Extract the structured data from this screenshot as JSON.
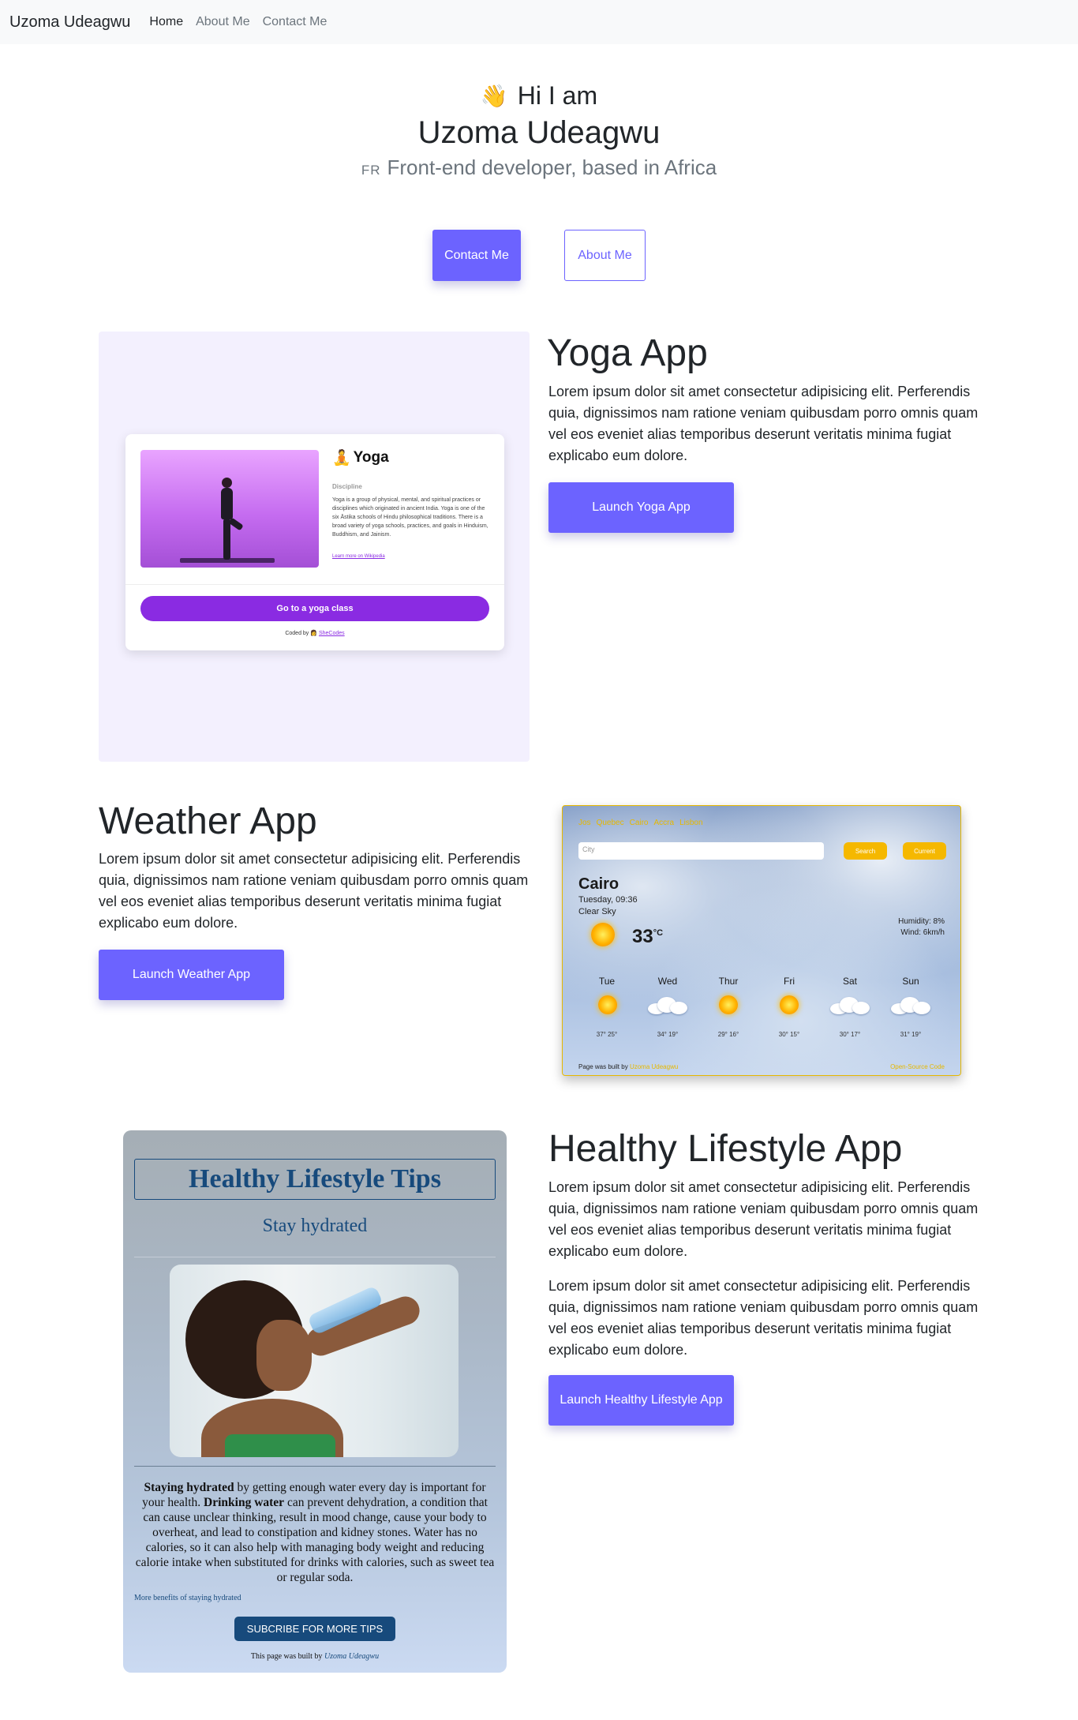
{
  "navbar": {
    "brand": "Uzoma Udeagwu",
    "links": [
      {
        "label": "Home",
        "active": true
      },
      {
        "label": "About Me",
        "active": false
      },
      {
        "label": "Contact Me",
        "active": false
      }
    ]
  },
  "hero": {
    "wave_icon": "waving-hand-icon",
    "greeting": "Hi I am",
    "name": "Uzoma Udeagwu",
    "flag_code": "FR",
    "tagline": "Front-end developer, based in Africa",
    "contact_button": "Contact Me",
    "about_button": "About Me"
  },
  "projects": [
    {
      "title": "Yoga App",
      "paragraphs": [
        "Lorem ipsum dolor sit amet consectetur adipisicing elit. Perferendis quia, dignissimos nam ratione veniam quibusdam porro omnis quam vel eos eveniet alias temporibus deserunt veritatis minima fugiat explicabo eum dolore."
      ],
      "button": "Launch Yoga App"
    },
    {
      "title": "Weather App",
      "paragraphs": [
        "Lorem ipsum dolor sit amet consectetur adipisicing elit. Perferendis quia, dignissimos nam ratione veniam quibusdam porro omnis quam vel eos eveniet alias temporibus deserunt veritatis minima fugiat explicabo eum dolore."
      ],
      "button": "Launch Weather App"
    },
    {
      "title": "Healthy Lifestyle App",
      "paragraphs": [
        "Lorem ipsum dolor sit amet consectetur adipisicing elit. Perferendis quia, dignissimos nam ratione veniam quibusdam porro omnis quam vel eos eveniet alias temporibus deserunt veritatis minima fugiat explicabo eum dolore.",
        "Lorem ipsum dolor sit amet consectetur adipisicing elit. Perferendis quia, dignissimos nam ratione veniam quibusdam porro omnis quam vel eos eveniet alias temporibus deserunt veritatis minima fugiat explicabo eum dolore."
      ],
      "button": "Launch Healthy Lifestyle App"
    }
  ],
  "yoga_preview": {
    "title": "Yoga",
    "title_icon": "person-in-lotus-position-icon",
    "subtitle": "Discipline",
    "description": "Yoga is a group of physical, mental, and spiritual practices or disciplines which originated in ancient India. Yoga is one of the six Āstika schools of Hindu philosophical traditions. There is a broad variety of yoga schools, practices, and goals in Hinduism, Buddhism, and Jainism.",
    "link": "Learn more on Wikipedia",
    "cta": "Go to a yoga class",
    "coded_by_prefix": "Coded by",
    "coded_by_icon": "shecodes-logo-icon",
    "coded_by_link": "SheCodes",
    "accent_color": "#8a2be2"
  },
  "weather_preview": {
    "cities": [
      "Jos",
      "Quebec",
      "Cairo",
      "Accra",
      "Lisbon"
    ],
    "search_placeholder": "City",
    "search_button": "Search",
    "current_button": "Current",
    "city": "Cairo",
    "date": "Tuesday, 09:36",
    "condition": "Clear Sky",
    "temperature": "33",
    "unit": "°C",
    "humidity": "Humidity: 8%",
    "wind": "Wind: 6km/h",
    "forecast": [
      {
        "day": "Tue",
        "icon": "sun-icon",
        "minmax": "37° 25°"
      },
      {
        "day": "Wed",
        "icon": "cloud-icon",
        "minmax": "34° 19°"
      },
      {
        "day": "Thur",
        "icon": "sun-icon",
        "minmax": "29° 16°"
      },
      {
        "day": "Fri",
        "icon": "sun-icon",
        "minmax": "30° 15°"
      },
      {
        "day": "Sat",
        "icon": "cloud-icon",
        "minmax": "30° 17°"
      },
      {
        "day": "Sun",
        "icon": "cloud-icon",
        "minmax": "31° 19°"
      }
    ],
    "footer_prefix": "Page was built by",
    "footer_author": "Uzoma Udeagwu",
    "footer_source": "Open-Source Code",
    "accent_color": "#e6b800"
  },
  "healthy_preview": {
    "title": "Healthy Lifestyle Tips",
    "subtitle": "Stay hydrated",
    "para_b1": "Staying hydrated",
    "para_t1": " by getting enough water every day is important for your health. ",
    "para_b2": "Drinking water",
    "para_t2": " can prevent dehydration, a condition that can cause unclear thinking, result in mood change, cause your body to overheat, and lead to constipation and kidney stones. Water has no calories, so it can also help with managing body weight and reducing calorie intake when substituted for drinks with calories, such as sweet tea or regular soda.",
    "more_link": "More benefits of staying hydrated",
    "subscribe_button": "SUBCRIBE FOR MORE TIPS",
    "built_prefix": "This page was built by",
    "built_author": "Uzoma Udeagwu",
    "accent_color": "#174a7c"
  },
  "colors": {
    "primary": "#6c63ff",
    "navbar_bg": "#f8f9fa",
    "yoga_frame_bg": "#f3f0fe"
  }
}
